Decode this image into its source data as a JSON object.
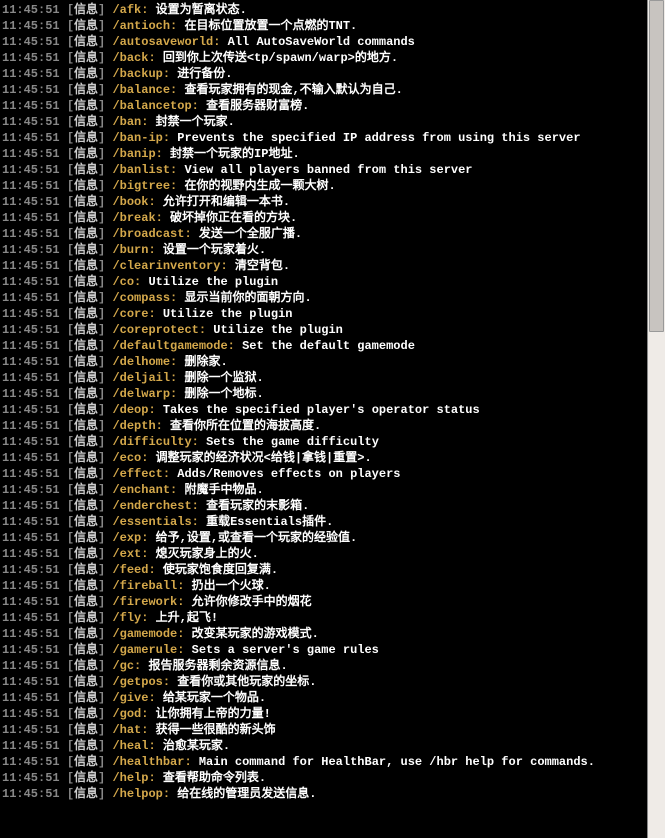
{
  "timestamp": "11:45:51",
  "info_label": "信息",
  "lines": [
    {
      "cmd": "/afk:",
      "desc": "设置为暂离状态."
    },
    {
      "cmd": "/antioch:",
      "desc": "在目标位置放置一个点燃的TNT."
    },
    {
      "cmd": "/autosaveworld:",
      "desc": "All AutoSaveWorld commands"
    },
    {
      "cmd": "/back:",
      "desc": "回到你上次传送<tp/spawn/warp>的地方."
    },
    {
      "cmd": "/backup:",
      "desc": "进行备份."
    },
    {
      "cmd": "/balance:",
      "desc": "查看玩家拥有的现金,不输入默认为自己."
    },
    {
      "cmd": "/balancetop:",
      "desc": "查看服务器财富榜."
    },
    {
      "cmd": "/ban:",
      "desc": "封禁一个玩家."
    },
    {
      "cmd": "/ban-ip:",
      "desc": "Prevents the specified IP address from using this server",
      "wrap": true
    },
    {
      "cmd": "/banip:",
      "desc": "封禁一个玩家的IP地址."
    },
    {
      "cmd": "/banlist:",
      "desc": "View all players banned from this server"
    },
    {
      "cmd": "/bigtree:",
      "desc": "在你的视野内生成一颗大树."
    },
    {
      "cmd": "/book:",
      "desc": "允许打开和编辑一本书."
    },
    {
      "cmd": "/break:",
      "desc": "破坏掉你正在看的方块."
    },
    {
      "cmd": "/broadcast:",
      "desc": "发送一个全服广播."
    },
    {
      "cmd": "/burn:",
      "desc": "设置一个玩家着火."
    },
    {
      "cmd": "/clearinventory:",
      "desc": "清空背包."
    },
    {
      "cmd": "/co:",
      "desc": "Utilize the plugin"
    },
    {
      "cmd": "/compass:",
      "desc": "显示当前你的面朝方向."
    },
    {
      "cmd": "/core:",
      "desc": "Utilize the plugin"
    },
    {
      "cmd": "/coreprotect:",
      "desc": "Utilize the plugin"
    },
    {
      "cmd": "/defaultgamemode:",
      "desc": "Set the default gamemode"
    },
    {
      "cmd": "/delhome:",
      "desc": "删除家."
    },
    {
      "cmd": "/deljail:",
      "desc": "删除一个监狱."
    },
    {
      "cmd": "/delwarp:",
      "desc": "删除一个地标."
    },
    {
      "cmd": "/deop:",
      "desc": "Takes the specified player's operator status"
    },
    {
      "cmd": "/depth:",
      "desc": "查看你所在位置的海拔高度."
    },
    {
      "cmd": "/difficulty:",
      "desc": "Sets the game difficulty"
    },
    {
      "cmd": "/eco:",
      "desc": "调整玩家的经济状况<给钱|拿钱|重置>."
    },
    {
      "cmd": "/effect:",
      "desc": "Adds/Removes effects on players"
    },
    {
      "cmd": "/enchant:",
      "desc": "附魔手中物品."
    },
    {
      "cmd": "/enderchest:",
      "desc": "查看玩家的末影箱."
    },
    {
      "cmd": "/essentials:",
      "desc": "重载Essentials插件."
    },
    {
      "cmd": "/exp:",
      "desc": "给予,设置,或查看一个玩家的经验值."
    },
    {
      "cmd": "/ext:",
      "desc": "熄灭玩家身上的火."
    },
    {
      "cmd": "/feed:",
      "desc": "使玩家饱食度回复满."
    },
    {
      "cmd": "/fireball:",
      "desc": "扔出一个火球."
    },
    {
      "cmd": "/firework:",
      "desc": "允许你修改手中的烟花"
    },
    {
      "cmd": "/fly:",
      "desc": "上升,起飞!"
    },
    {
      "cmd": "/gamemode:",
      "desc": "改变某玩家的游戏模式."
    },
    {
      "cmd": "/gamerule:",
      "desc": "Sets a server's game rules"
    },
    {
      "cmd": "/gc:",
      "desc": "报告服务器剩余资源信息."
    },
    {
      "cmd": "/getpos:",
      "desc": "查看你或其他玩家的坐标."
    },
    {
      "cmd": "/give:",
      "desc": "给某玩家一个物品."
    },
    {
      "cmd": "/god:",
      "desc": "让你拥有上帝的力量!"
    },
    {
      "cmd": "/hat:",
      "desc": "获得一些很酷的新头饰"
    },
    {
      "cmd": "/heal:",
      "desc": "治愈某玩家."
    },
    {
      "cmd": "/healthbar:",
      "desc": "Main command for HealthBar, use /hbr help for commands.",
      "wrap": true
    },
    {
      "cmd": "/help:",
      "desc": "查看帮助命令列表."
    },
    {
      "cmd": "/helpop:",
      "desc": "给在线的管理员发送信息."
    }
  ]
}
